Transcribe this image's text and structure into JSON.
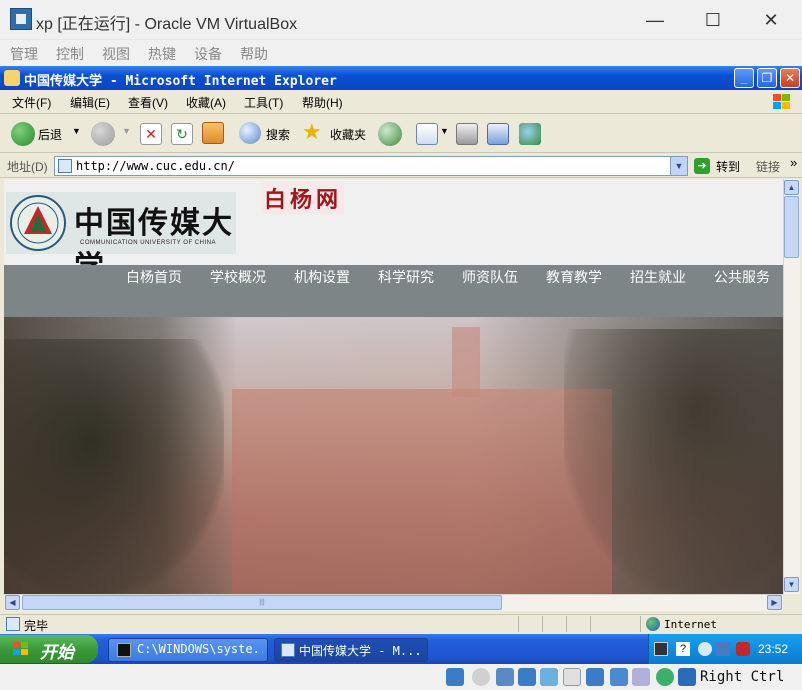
{
  "vbox": {
    "title": "xp [正在运行] - Oracle VM VirtualBox",
    "menu": [
      "管理",
      "控制",
      "视图",
      "热键",
      "设备",
      "帮助"
    ],
    "host_key": "Right Ctrl"
  },
  "ie": {
    "title": "中国传媒大学 - Microsoft Internet Explorer",
    "menu": [
      "文件(F)",
      "编辑(E)",
      "查看(V)",
      "收藏(A)",
      "工具(T)",
      "帮助(H)"
    ],
    "toolbar": {
      "back": "后退",
      "search": "搜索",
      "favorites": "收藏夹"
    },
    "address_label": "地址(D)",
    "address": "http://www.cuc.edu.cn/",
    "go": "转到",
    "links": "链接",
    "status": "完毕",
    "zone": "Internet"
  },
  "site": {
    "logo_cn": "中国传媒大学",
    "logo_en": "COMMUNICATION UNIVERSITY OF CHINA",
    "baiyang": "白杨网",
    "nav": [
      "白杨首页",
      "学校概况",
      "机构设置",
      "科学研究",
      "师资队伍",
      "教育教学",
      "招生就业",
      "公共服务"
    ]
  },
  "taskbar": {
    "start": "开始",
    "tasks": [
      "C:\\WINDOWS\\syste...",
      "中国传媒大学 - M..."
    ],
    "clock": "23:52"
  },
  "colors": {
    "xp_blue": "#0a4fd3",
    "nav_gray": "#7d8586",
    "start_green": "#3b9a3b"
  }
}
